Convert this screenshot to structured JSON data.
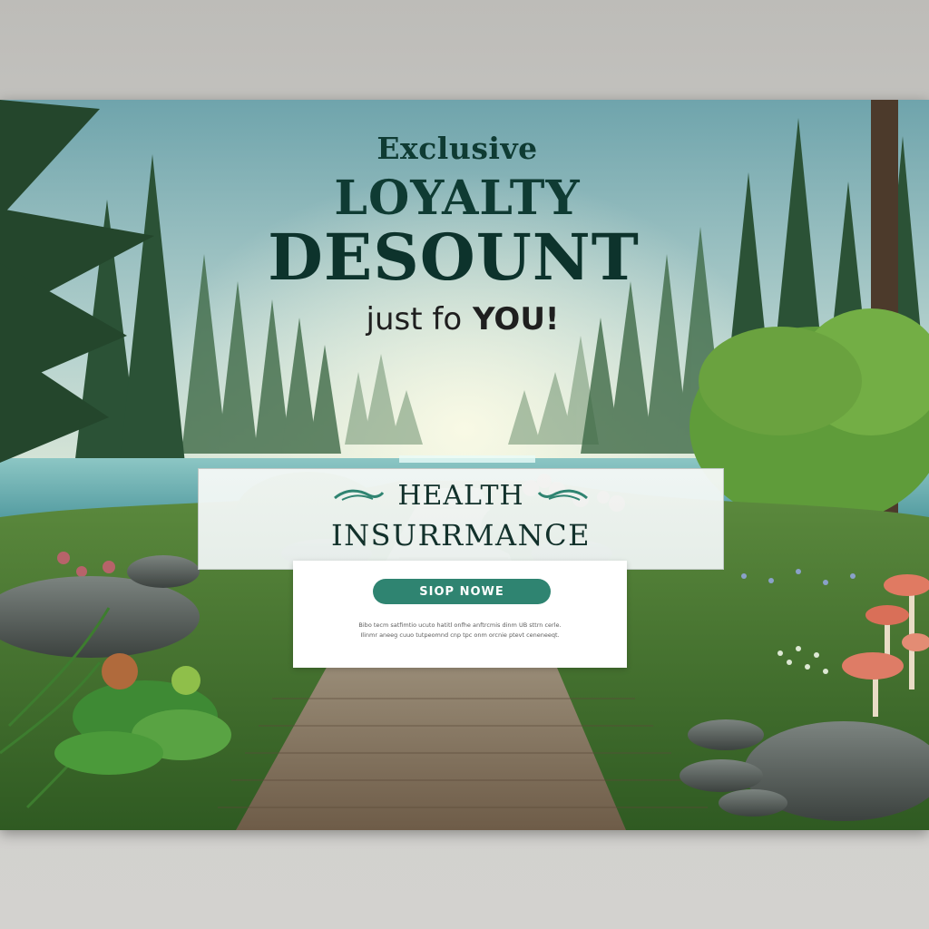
{
  "headline": {
    "line1": "Exclusive",
    "line2": "LOYALTY",
    "line3": "DESOUNT",
    "line4_part1": "just fo",
    "line4_part2": " YOU!"
  },
  "product": {
    "line1": "HEALTH",
    "line2": "INSURRMANCE"
  },
  "cta": {
    "button_label": "SIOP NOWE",
    "fine_print_line1": "Bibo tecm satfimtio ucuto hatitl onfhe anftrcmis dinm UB sttrn cerle.",
    "fine_print_line2": "Ilinmr aneeg cuuo tutpeomnd cnp tpc onm orcnie ptevt ceneneeqt."
  },
  "colors": {
    "brand_green": "#2f8471",
    "headline": "#0f3b33",
    "card_bg": "#ffffff"
  }
}
